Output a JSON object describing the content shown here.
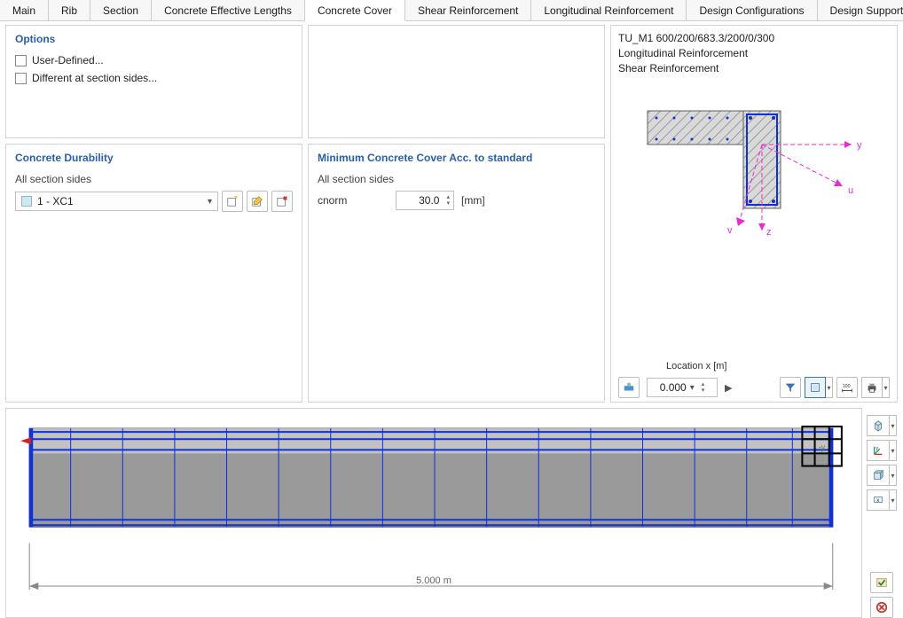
{
  "tabs": {
    "items": [
      "Main",
      "Rib",
      "Section",
      "Concrete Effective Lengths",
      "Concrete Cover",
      "Shear Reinforcement",
      "Longitudinal Reinforcement",
      "Design Configurations",
      "Design Supports & Deflection"
    ],
    "active_index": 4
  },
  "options": {
    "title": "Options",
    "user_defined": "User-Defined...",
    "different_sides": "Different at section sides..."
  },
  "durability": {
    "title": "Concrete Durability",
    "subtitle": "All section sides",
    "selected": "1 - XC1"
  },
  "min_cover": {
    "title": "Minimum Concrete Cover Acc. to standard",
    "subtitle": "All section sides",
    "label": "cnorm",
    "value": "30.0",
    "unit": "[mm]"
  },
  "right": {
    "line1": "TU_M1 600/200/683.3/200/0/300",
    "line2": "Longitudinal Reinforcement",
    "line3": "Shear Reinforcement",
    "location_title": "Location x [m]",
    "location_value": "0.000",
    "axis_y": "y",
    "axis_u": "u",
    "axis_v": "v",
    "axis_z": "z"
  },
  "beam": {
    "length_label": "5.000 m"
  }
}
